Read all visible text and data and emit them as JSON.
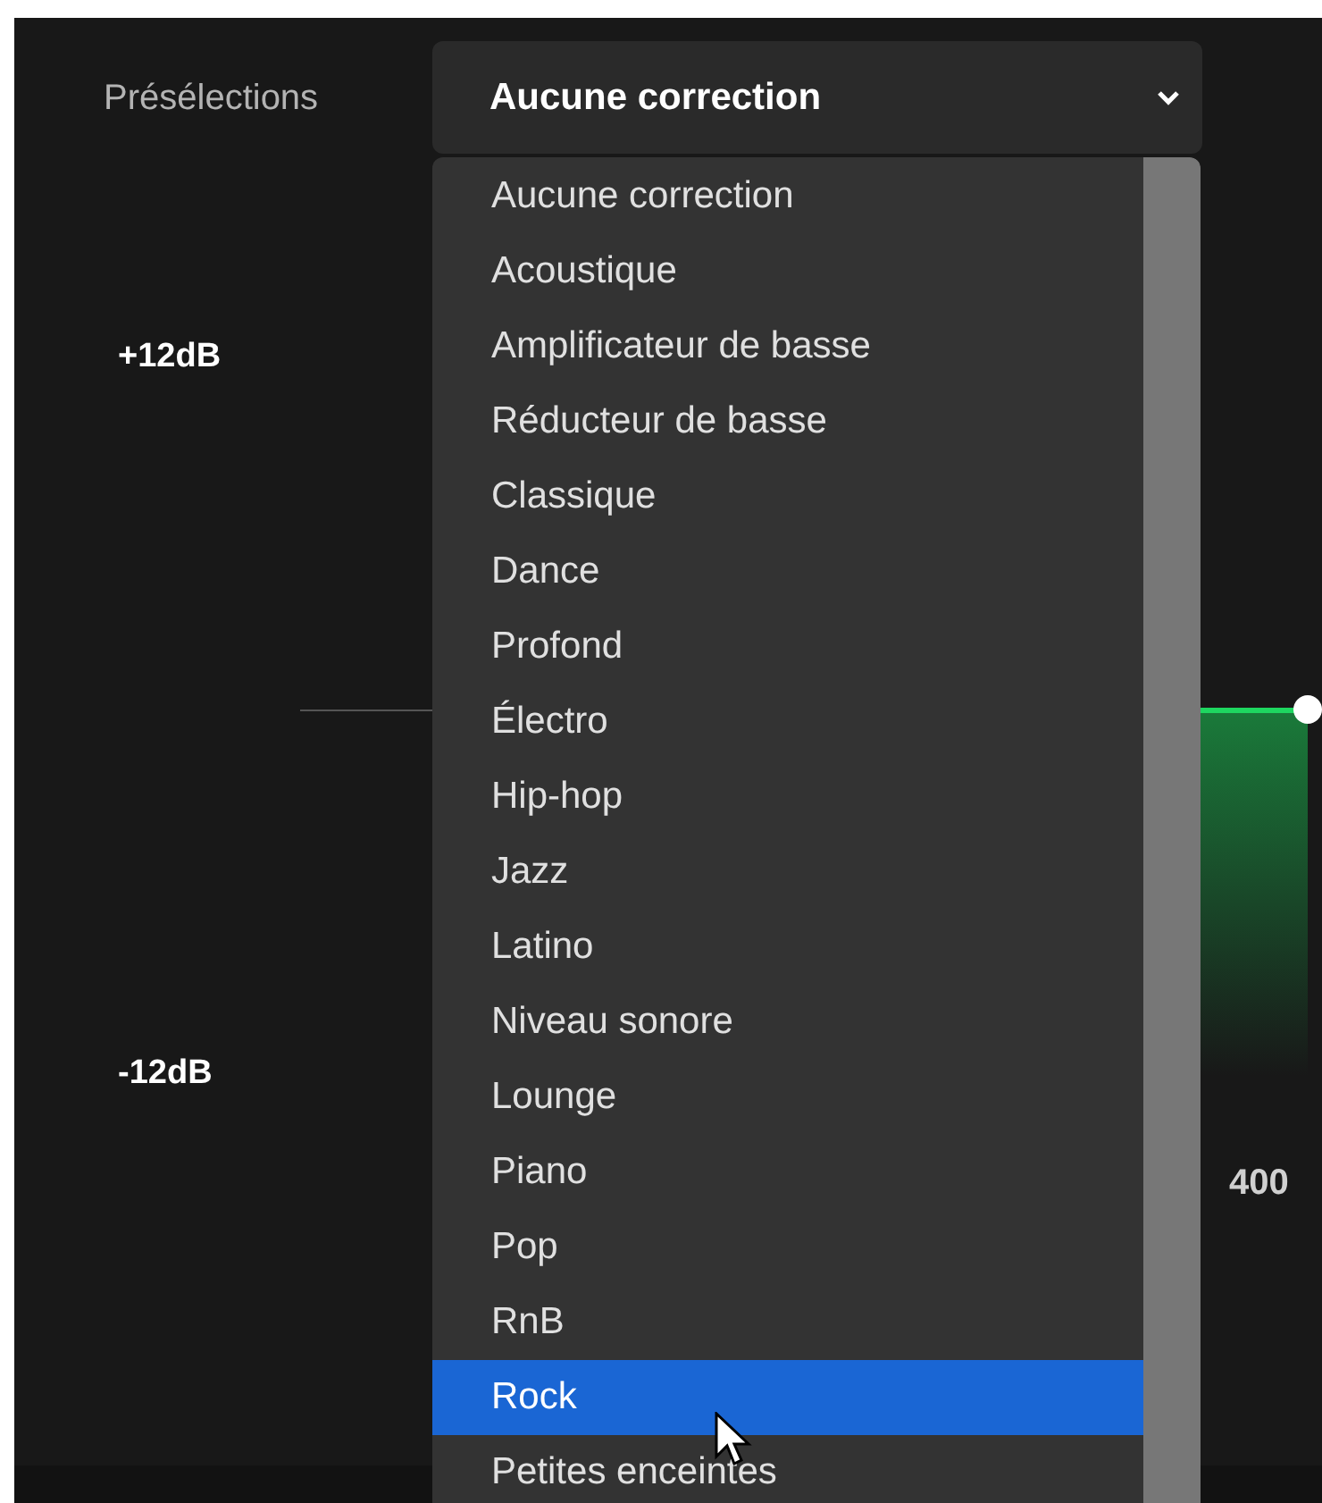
{
  "presets": {
    "label": "Présélections",
    "value": "Aucune correction",
    "options": [
      {
        "label": "Aucune correction",
        "highlighted": false
      },
      {
        "label": "Acoustique",
        "highlighted": false
      },
      {
        "label": "Amplificateur de basse",
        "highlighted": false
      },
      {
        "label": "Réducteur de basse",
        "highlighted": false
      },
      {
        "label": "Classique",
        "highlighted": false
      },
      {
        "label": "Dance",
        "highlighted": false
      },
      {
        "label": "Profond",
        "highlighted": false
      },
      {
        "label": "Électro",
        "highlighted": false
      },
      {
        "label": "Hip-hop",
        "highlighted": false
      },
      {
        "label": "Jazz",
        "highlighted": false
      },
      {
        "label": "Latino",
        "highlighted": false
      },
      {
        "label": "Niveau sonore",
        "highlighted": false
      },
      {
        "label": "Lounge",
        "highlighted": false
      },
      {
        "label": "Piano",
        "highlighted": false
      },
      {
        "label": "Pop",
        "highlighted": false
      },
      {
        "label": "RnB",
        "highlighted": false
      },
      {
        "label": "Rock",
        "highlighted": true
      },
      {
        "label": "Petites enceintes",
        "highlighted": false
      }
    ]
  },
  "equalizer": {
    "gain_labels": [
      "+12dB",
      "-12dB"
    ],
    "frequency_label": "400"
  }
}
